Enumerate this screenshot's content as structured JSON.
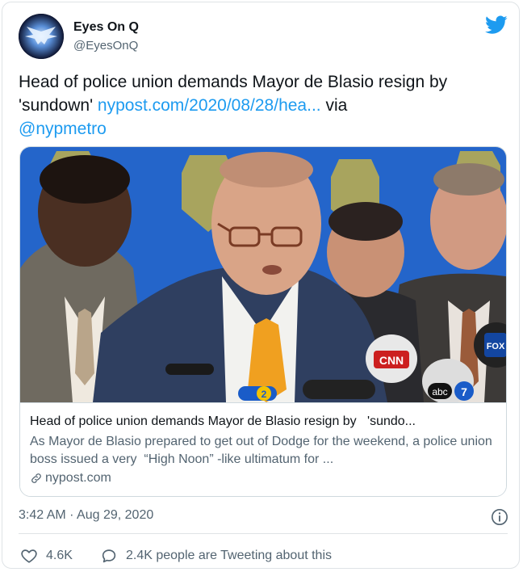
{
  "author": {
    "display_name": "Eyes On Q",
    "handle": "@EyesOnQ"
  },
  "tweet": {
    "text_before": "Head of police union demands Mayor de Blasio resign by 'sundown' ",
    "link_url": "nypost.com/2020/08/28/hea...",
    "text_via": " via ",
    "mention": "@nypmetro"
  },
  "link_card": {
    "title": "Head of police union demands Mayor de Blasio resign by   'sundo...",
    "description": "As Mayor de Blasio prepared to get out of Dodge for the weekend, a police union boss issued a very  “High Noon” -like ultimatum for ...",
    "domain": "nypost.com",
    "image_labels": {
      "cnn": "CNN",
      "fox": "FOX",
      "abc": "abc",
      "channel2": "2",
      "channel7": "7"
    }
  },
  "footer": {
    "timestamp": "3:42 AM · Aug 29, 2020",
    "likes": "4.6K",
    "replies_text": "2.4K people are Tweeting about this"
  },
  "colors": {
    "brand_blue": "#1d9bf0",
    "muted_text": "#536471",
    "border": "#cfd9de"
  },
  "icons": [
    "twitter-bird-icon",
    "link-icon",
    "info-icon",
    "heart-icon",
    "reply-bubble-icon"
  ]
}
